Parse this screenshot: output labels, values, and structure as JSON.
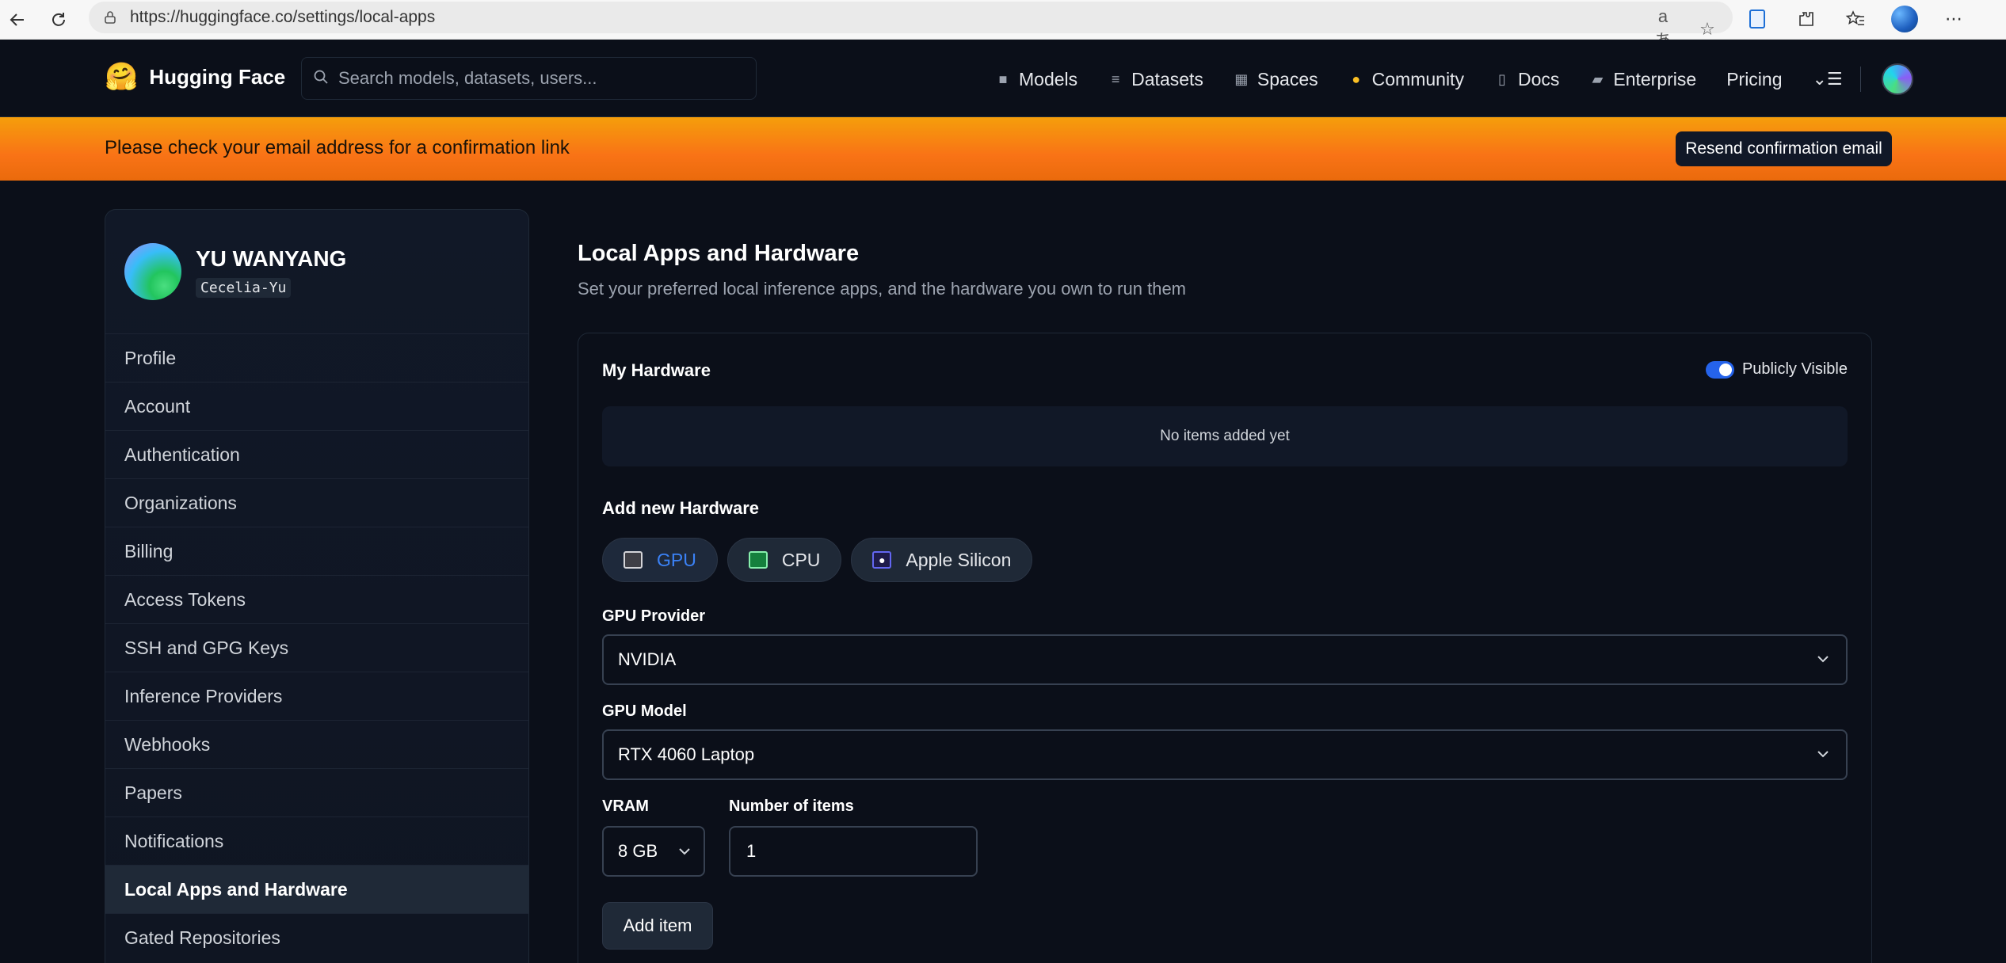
{
  "browser": {
    "url": "https://huggingface.co/settings/local-apps",
    "translate_icon": "aあ"
  },
  "header": {
    "brand": "Hugging Face",
    "logo_glyph": "🤗",
    "search_placeholder": "Search models, datasets, users...",
    "nav": [
      {
        "label": "Models",
        "icon": "cube-icon"
      },
      {
        "label": "Datasets",
        "icon": "database-icon"
      },
      {
        "label": "Spaces",
        "icon": "grid-icon"
      },
      {
        "label": "Community",
        "icon": "community-icon"
      },
      {
        "label": "Docs",
        "icon": "book-icon"
      },
      {
        "label": "Enterprise",
        "icon": "enterprise-icon"
      },
      {
        "label": "Pricing",
        "icon": ""
      }
    ],
    "menu_glyph": "⌄☰"
  },
  "banner": {
    "message": "Please check your email address for a confirmation link",
    "button": "Resend confirmation email"
  },
  "sidebar": {
    "user_name": "YU WANYANG",
    "user_handle": "Cecelia-Yu",
    "items": [
      {
        "label": "Profile",
        "active": false
      },
      {
        "label": "Account",
        "active": false
      },
      {
        "label": "Authentication",
        "active": false
      },
      {
        "label": "Organizations",
        "active": false
      },
      {
        "label": "Billing",
        "active": false
      },
      {
        "label": "Access Tokens",
        "active": false
      },
      {
        "label": "SSH and GPG Keys",
        "active": false
      },
      {
        "label": "Inference Providers",
        "active": false
      },
      {
        "label": "Webhooks",
        "active": false
      },
      {
        "label": "Papers",
        "active": false
      },
      {
        "label": "Notifications",
        "active": false
      },
      {
        "label": "Local Apps and Hardware",
        "active": true
      },
      {
        "label": "Gated Repositories",
        "active": false
      }
    ]
  },
  "main": {
    "title": "Local Apps and Hardware",
    "subtitle": "Set your preferred local inference apps, and the hardware you own to run them",
    "my_hardware": {
      "title": "My Hardware",
      "visibility_label": "Publicly Visible",
      "visibility_on": true,
      "empty_text": "No items added yet"
    },
    "add_hardware": {
      "title": "Add new Hardware",
      "tabs": [
        {
          "label": "GPU",
          "icon": "gpu-icon",
          "active": true
        },
        {
          "label": "CPU",
          "icon": "cpu-icon",
          "active": false
        },
        {
          "label": "Apple Silicon",
          "icon": "apple-silicon-icon",
          "active": false
        }
      ],
      "provider_label": "GPU Provider",
      "provider_value": "NVIDIA",
      "model_label": "GPU Model",
      "model_value": "RTX 4060 Laptop",
      "vram_label": "VRAM",
      "vram_value": "8 GB",
      "count_label": "Number of items",
      "count_value": "1",
      "add_button": "Add item"
    }
  },
  "colors": {
    "background": "#0b0f19",
    "accent": "#2563eb",
    "banner": "#f59e0b"
  }
}
